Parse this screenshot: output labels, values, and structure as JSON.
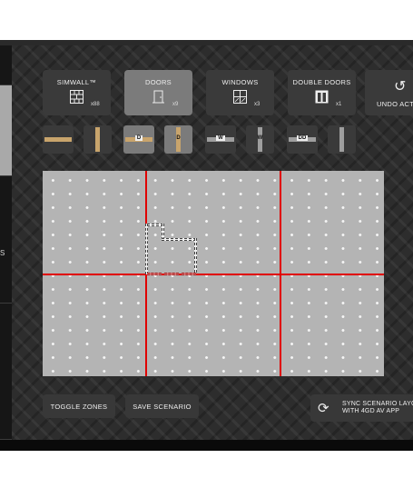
{
  "toolbar": {
    "tools": [
      {
        "label": "SIMWALL™",
        "count": "x88",
        "icon": "brick-wall-icon"
      },
      {
        "label": "DOORS",
        "count": "x9",
        "icon": "door-icon"
      },
      {
        "label": "WINDOWS",
        "count": "x3",
        "icon": "window-icon"
      },
      {
        "label": "DOUBLE DOORS",
        "count": "x1",
        "icon": "double-door-icon"
      }
    ],
    "undo_label": "UNDO ACT",
    "undo_icon": "undo-icon"
  },
  "variants": [
    {
      "letter": ""
    },
    {
      "letter": ""
    },
    {
      "letter": "D"
    },
    {
      "letter": "D"
    },
    {
      "letter": "W"
    },
    {
      "letter": "W"
    },
    {
      "letter": "DD"
    },
    {
      "letter": ""
    }
  ],
  "rail": {
    "side_label": "S"
  },
  "actions": {
    "toggle_zones": "TOGGLE ZONES",
    "save_scenario": "SAVE SCENARIO",
    "sync_line1": "SYNC SCENARIO LAYO",
    "sync_line2": "WITH 4GD AV APP",
    "sync_icon": "sync-icon"
  },
  "colors": {
    "zone_line": "#e00000",
    "active_tool": "#7b7b7b",
    "wood": "#c8a46c"
  }
}
